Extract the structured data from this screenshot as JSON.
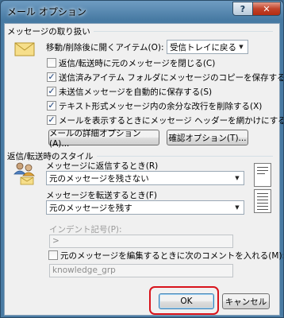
{
  "window": {
    "title": "メール オプション",
    "help_glyph": "?",
    "close_glyph": "✕"
  },
  "messages": {
    "group_label": "メッセージの取り扱い",
    "after_move_label": "移動/削除後に開くアイテム(O):",
    "after_move_value": "受信トレイに戻る",
    "checkboxes": [
      {
        "label": "返信/転送時に元のメッセージを閉じる(C)",
        "checked": false
      },
      {
        "label": "送信済みアイテム フォルダにメッセージのコピーを保存する(V)",
        "checked": true
      },
      {
        "label": "未送信メッセージを自動的に保存する(S)",
        "checked": true
      },
      {
        "label": "テキスト形式メッセージ内の余分な改行を削除する(X)",
        "checked": true
      },
      {
        "label": "メールを表示するときにメッセージ ヘッダーを網かけにする(H)",
        "checked": true
      }
    ],
    "advanced_button": "メールの詳細オプション(A)...",
    "tracking_button": "確認オプション(T)..."
  },
  "reply": {
    "group_label": "返信/転送時のスタイル",
    "reply_label": "メッセージに返信するとき(R)",
    "reply_value": "元のメッセージを残さない",
    "forward_label": "メッセージを転送するとき(F)",
    "forward_value": "元のメッセージを残す",
    "indent_label": "インデント記号(P):",
    "indent_value": ">",
    "comment_checkbox_label": "元のメッセージを編集するときに次のコメントを入れる(M):",
    "comment_checked": false,
    "comment_value": "knowledge_grp"
  },
  "footer": {
    "ok_label": "OK",
    "cancel_label": "キャンセル"
  },
  "colors": {
    "highlight_ring": "#d8141c",
    "titlebar": "#477aa3",
    "client_bg": "#f0f0f0"
  },
  "icons": {
    "message_handling": "envelope-icon",
    "reply_style": "people-reply-icon"
  }
}
